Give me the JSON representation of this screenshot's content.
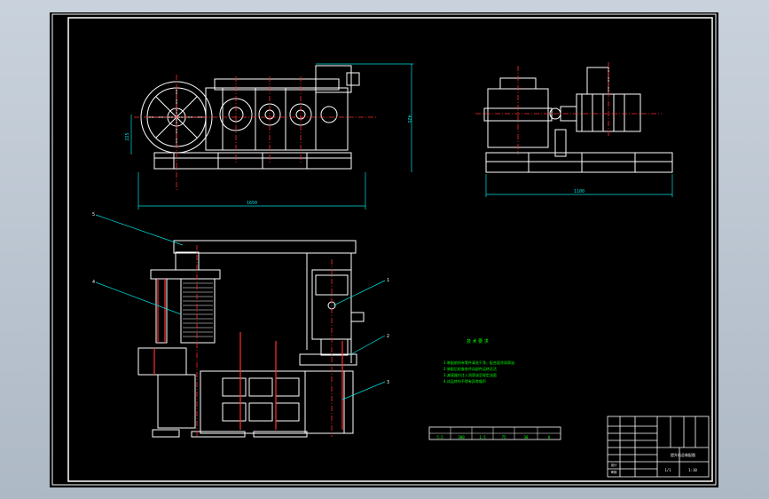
{
  "window": {
    "background_color": "#b9c3cf",
    "sheet_color": "#000000"
  },
  "callouts": [
    "5",
    "4",
    "1",
    "2",
    "3"
  ],
  "dimensions": {
    "front_height": "225",
    "front_right_height": "425",
    "front_width": "1650",
    "side_width": "1100"
  },
  "tech_requirements": {
    "title": "技 术 要 求",
    "lines": [
      "1.装配前所有零件清洗干净，配合面涂润滑油",
      "2.装配后检查各传动部件运转灵活",
      "3.减速器内注入润滑油至规定油面",
      "4.试运转时不得有异常噪声"
    ]
  },
  "params_table": {
    "cells": [
      "5.5",
      "380",
      "1.5",
      "75",
      "30",
      "8"
    ]
  },
  "title_block": {
    "drawing_name": "提升机总装配图",
    "scale": "1:10",
    "sheet": "1/1",
    "designer_label": "设计",
    "checker_label": "审核"
  },
  "colors": {
    "white_line": "#ffffff",
    "center_line": "#ff2a2a",
    "hatch": "#ff3030",
    "dimension": "#00e0e0",
    "text_green": "#00ff00",
    "border": "#ffffff"
  }
}
